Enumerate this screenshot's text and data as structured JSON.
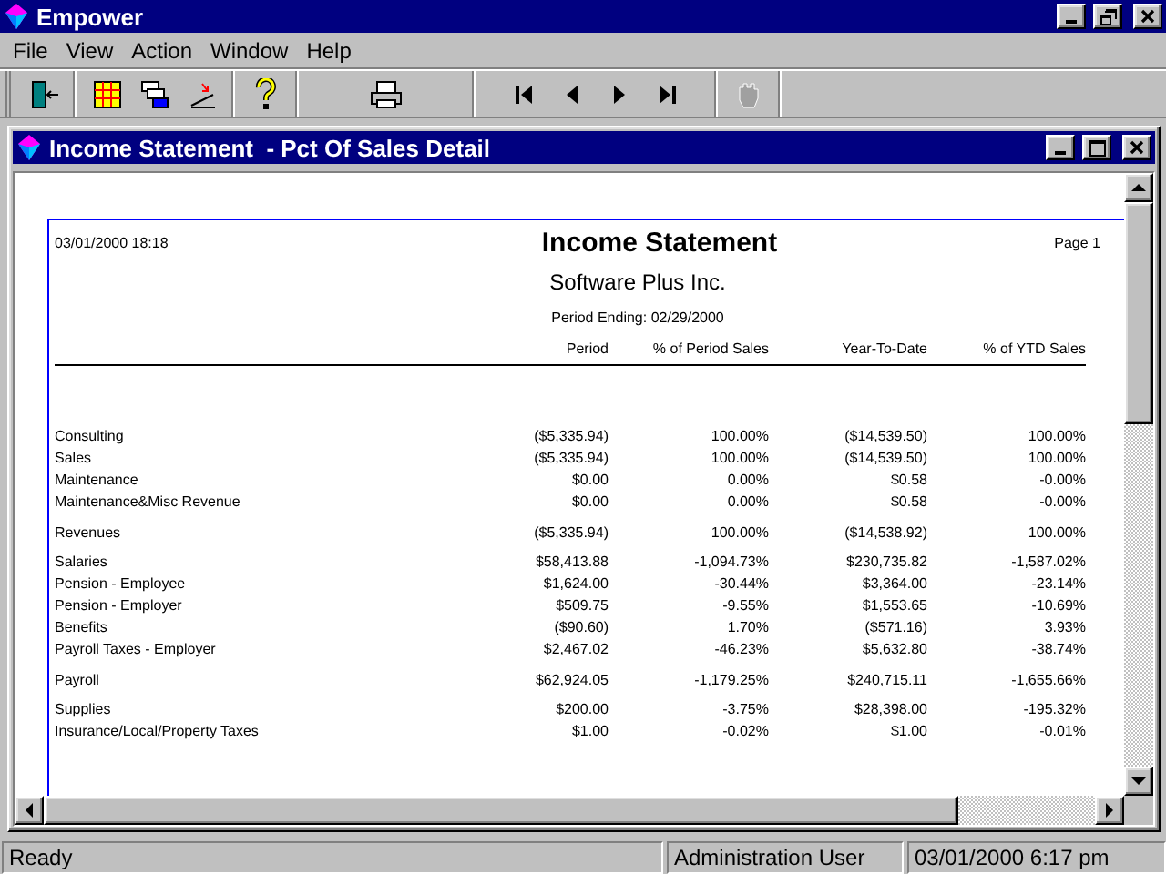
{
  "app": {
    "title": "Empower"
  },
  "menu": [
    "File",
    "View",
    "Action",
    "Window",
    "Help"
  ],
  "toolbar": [
    [
      {
        "kind": "exit",
        "disabled": false
      }
    ],
    [
      {
        "kind": "grid",
        "disabled": false
      },
      {
        "kind": "cascade",
        "disabled": false
      },
      {
        "kind": "import",
        "disabled": false
      }
    ],
    [
      {
        "kind": "help",
        "disabled": false
      }
    ],
    [
      {
        "kind": "print",
        "disabled": false
      }
    ],
    [
      {
        "kind": "first",
        "disabled": false
      },
      {
        "kind": "prev",
        "disabled": false
      },
      {
        "kind": "next",
        "disabled": false
      },
      {
        "kind": "last",
        "disabled": false
      }
    ],
    [
      {
        "kind": "stop",
        "disabled": true
      }
    ]
  ],
  "document": {
    "title": "Income Statement  - Pct Of Sales Detail"
  },
  "report": {
    "printed": "03/01/2000 18:18",
    "title": "Income Statement",
    "page": "Page 1",
    "company": "Software Plus Inc.",
    "period_ending": "Period Ending: 02/29/2000",
    "columns": [
      "Period",
      "% of Period Sales",
      "Year-To-Date",
      "% of YTD Sales"
    ],
    "sections": [
      {
        "rows": [
          {
            "kind": "detail",
            "label": "Consulting",
            "values": [
              "($5,335.94)",
              "100.00%",
              "($14,539.50)",
              "100.00%"
            ]
          },
          {
            "kind": "detail",
            "label": "Sales",
            "values": [
              "($5,335.94)",
              "100.00%",
              "($14,539.50)",
              "100.00%"
            ]
          },
          {
            "kind": "detail",
            "label": "Maintenance",
            "values": [
              "$0.00",
              "0.00%",
              "$0.58",
              "-0.00%"
            ]
          },
          {
            "kind": "detail",
            "label": "Maintenance&Misc Revenue",
            "values": [
              "$0.00",
              "0.00%",
              "$0.58",
              "-0.00%"
            ]
          },
          {
            "kind": "total",
            "label": "Revenues",
            "values": [
              "($5,335.94)",
              "100.00%",
              "($14,538.92)",
              "100.00%"
            ]
          }
        ]
      },
      {
        "rows": [
          {
            "kind": "detail",
            "label": "Salaries",
            "values": [
              "$58,413.88",
              "-1,094.73%",
              "$230,735.82",
              "-1,587.02%"
            ]
          },
          {
            "kind": "detail",
            "label": "Pension - Employee",
            "values": [
              "$1,624.00",
              "-30.44%",
              "$3,364.00",
              "-23.14%"
            ]
          },
          {
            "kind": "detail",
            "label": "Pension - Employer",
            "values": [
              "$509.75",
              "-9.55%",
              "$1,553.65",
              "-10.69%"
            ]
          },
          {
            "kind": "detail",
            "label": "Benefits",
            "values": [
              "($90.60)",
              "1.70%",
              "($571.16)",
              "3.93%"
            ]
          },
          {
            "kind": "detail",
            "label": "Payroll Taxes - Employer",
            "values": [
              "$2,467.02",
              "-46.23%",
              "$5,632.80",
              "-38.74%"
            ]
          },
          {
            "kind": "total",
            "label": "Payroll",
            "values": [
              "$62,924.05",
              "-1,179.25%",
              "$240,715.11",
              "-1,655.66%"
            ]
          }
        ]
      },
      {
        "rows": [
          {
            "kind": "detail",
            "label": "Supplies",
            "values": [
              "$200.00",
              "-3.75%",
              "$28,398.00",
              "-195.32%"
            ]
          },
          {
            "kind": "detail",
            "label": "Insurance/Local/Property Taxes",
            "values": [
              "$1.00",
              "-0.02%",
              "$1.00",
              "-0.01%"
            ]
          }
        ]
      }
    ]
  },
  "status_bar": [
    "Ready",
    "Administration User",
    "03/01/2000 6:17 pm"
  ]
}
